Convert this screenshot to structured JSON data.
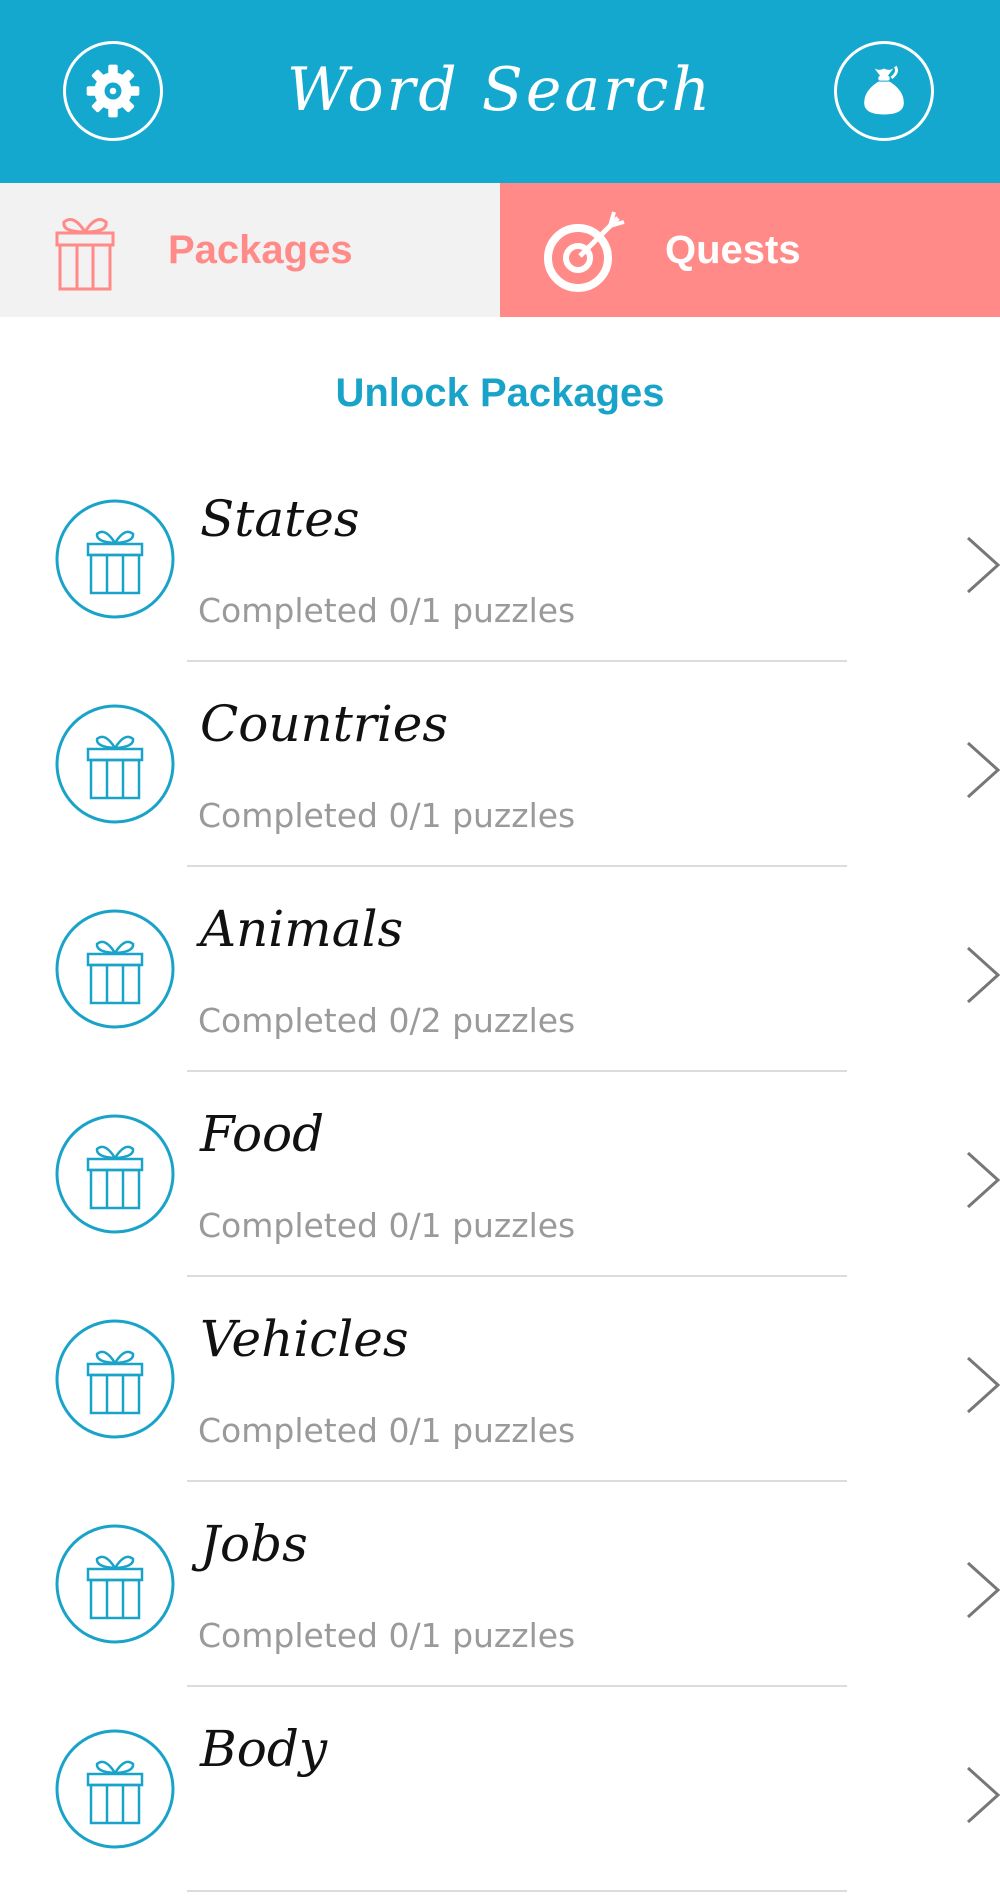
{
  "header": {
    "title": "Word Search",
    "settings_icon": "gear-icon",
    "bag_icon": "money-bag-icon",
    "background_color": "#15a8cf"
  },
  "tabs": [
    {
      "label": "Packages",
      "icon": "gift-icon",
      "active": true
    },
    {
      "label": "Quests",
      "icon": "target-arrow-icon",
      "active": false
    }
  ],
  "section_heading": "Unlock Packages",
  "packages": [
    {
      "name": "States",
      "progress": "Completed 0/1 puzzles"
    },
    {
      "name": "Countries",
      "progress": "Completed 0/1 puzzles"
    },
    {
      "name": "Animals",
      "progress": "Completed 0/2 puzzles"
    },
    {
      "name": "Food",
      "progress": "Completed 0/1 puzzles"
    },
    {
      "name": "Vehicles",
      "progress": "Completed 0/1 puzzles"
    },
    {
      "name": "Jobs",
      "progress": "Completed 0/1 puzzles"
    },
    {
      "name": "Body",
      "progress": ""
    }
  ],
  "colors": {
    "accent_blue": "#15a8cf",
    "accent_pink": "#ff8a88",
    "tab_inactive_bg": "#f2f2f2",
    "progress_text": "#9a9a9a"
  }
}
